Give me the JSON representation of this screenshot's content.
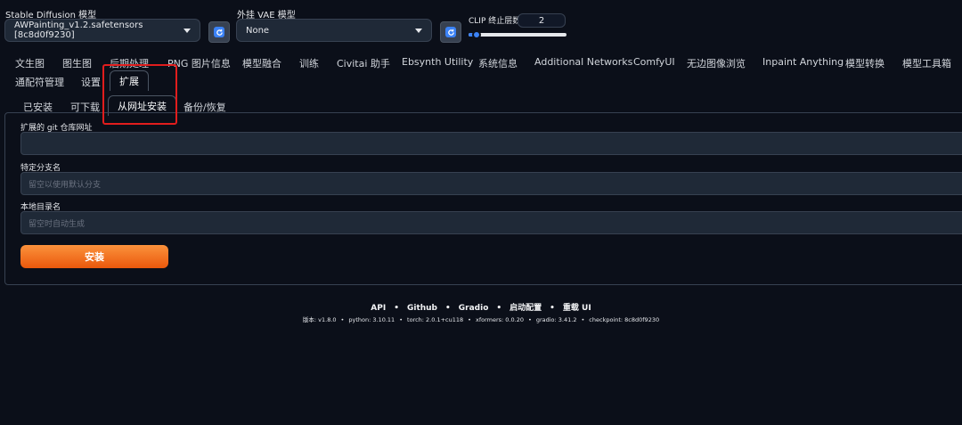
{
  "model_selector": {
    "label": "Stable Diffusion 模型",
    "value": "AWPainting_v1.2.safetensors [8c8d0f9230]"
  },
  "vae_selector": {
    "label": "外挂 VAE 模型",
    "value": "None"
  },
  "clip": {
    "label": "CLIP 终止层数",
    "value": "2",
    "slider_fraction": 0.08
  },
  "main_tabs": [
    {
      "label": "文生图"
    },
    {
      "label": "图生图"
    },
    {
      "label": "后期处理"
    },
    {
      "label": "PNG 图片信息"
    },
    {
      "label": "模型融合"
    },
    {
      "label": "训练"
    },
    {
      "label": "Civitai 助手"
    },
    {
      "label": "Ebsynth Utility"
    },
    {
      "label": "系统信息"
    },
    {
      "label": "Additional Networks"
    },
    {
      "label": "ComfyUI"
    },
    {
      "label": "无边图像浏览"
    },
    {
      "label": "Inpaint Anything"
    },
    {
      "label": "模型转换"
    },
    {
      "label": "模型工具箱"
    },
    {
      "label": "通配符管理"
    },
    {
      "label": "设置"
    },
    {
      "label": "扩展"
    }
  ],
  "sub_tabs": [
    {
      "label": "已安装"
    },
    {
      "label": "可下载"
    },
    {
      "label": "从网址安装"
    },
    {
      "label": "备份/恢复"
    }
  ],
  "form": {
    "git_url_label": "扩展的 git 仓库网址",
    "git_url_value": "",
    "branch_label": "特定分支名",
    "branch_placeholder": "留空以使用默认分支",
    "dir_label": "本地目录名",
    "dir_placeholder": "留空时自动生成",
    "install_label": "安装"
  },
  "footer": {
    "links": [
      "API",
      "Github",
      "Gradio",
      "启动配置",
      "重载 UI"
    ],
    "info": [
      "版本: v1.8.0",
      "python: 3.10.11",
      "torch: 2.0.1+cu118",
      "xformers: 0.0.20",
      "gradio: 3.41.2",
      "checkpoint: 8c8d0f9230"
    ]
  },
  "colors": {
    "background": "#0b0f19",
    "accent_orange": "#ea580c",
    "highlight_red": "#e11d1d",
    "refresh_blue": "#3b82f6"
  }
}
